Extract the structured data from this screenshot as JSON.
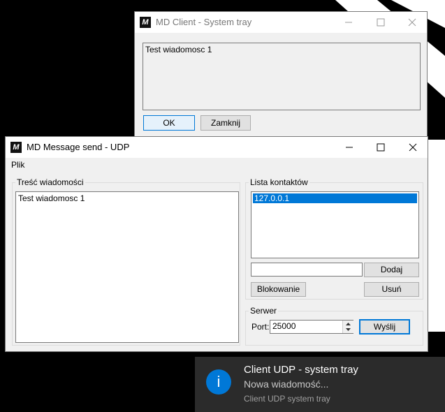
{
  "client_window": {
    "title": "MD Client - System tray",
    "message": "Test wiadomosc 1",
    "ok_label": "OK",
    "close_label": "Zamknij"
  },
  "send_window": {
    "title": "MD Message send - UDP",
    "menu": {
      "file_label": "Plik"
    },
    "message_group": {
      "label": "Treść wiadomości",
      "text": "Test wiadomosc 1"
    },
    "contacts_group": {
      "label": "Lista kontaktów",
      "items": [
        "127.0.0.1"
      ],
      "selected_index": 0,
      "new_contact_value": "",
      "add_label": "Dodaj",
      "block_label": "Blokowanie",
      "remove_label": "Usuń"
    },
    "server_group": {
      "label": "Serwer",
      "port_label": "Port:",
      "port_value": "25000",
      "send_label": "Wyślij"
    }
  },
  "notification": {
    "title": "Client UDP - system tray",
    "body": "Nowa wiadomość...",
    "source": "Client UDP system tray",
    "icon": "info-icon"
  },
  "colors": {
    "accent": "#0078d7",
    "window_bg": "#f0f0f0",
    "toast_bg": "#2b2b2b"
  }
}
